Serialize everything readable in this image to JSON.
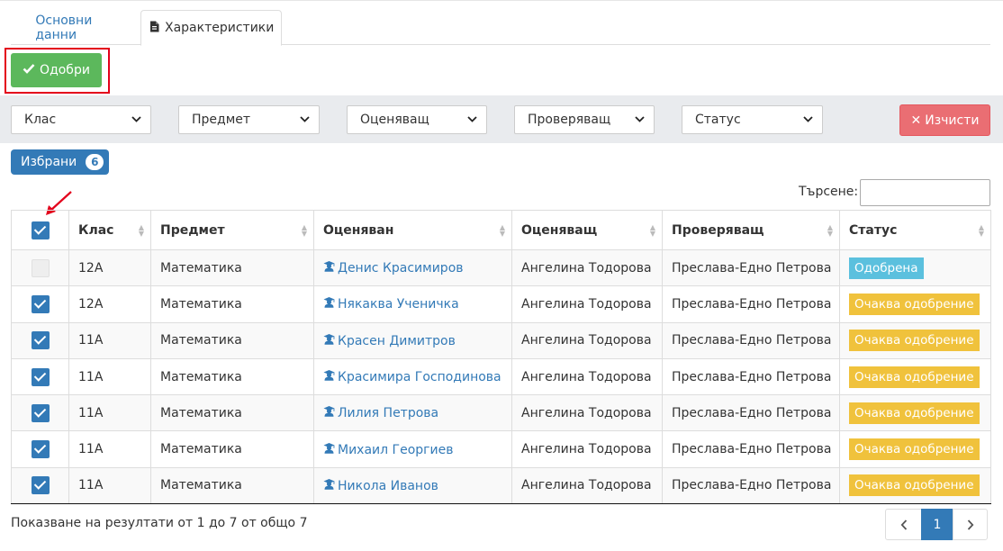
{
  "tabs": [
    {
      "label": "Основни данни",
      "icon": "grid-icon"
    },
    {
      "label": "Характеристики",
      "icon": "file-icon"
    }
  ],
  "toolbar": {
    "approve_label": "Одобри"
  },
  "filters": [
    {
      "label": "Клас"
    },
    {
      "label": "Предмет"
    },
    {
      "label": "Оценяващ"
    },
    {
      "label": "Проверяващ"
    },
    {
      "label": "Статус"
    }
  ],
  "clear_label": "Изчисти",
  "selected": {
    "label": "Избрани",
    "count": "6"
  },
  "search": {
    "label": "Търсене:",
    "value": ""
  },
  "table": {
    "headers": [
      "Клас",
      "Предмет",
      "Оценяван",
      "Оценяващ",
      "Проверяващ",
      "Статус"
    ],
    "rows": [
      {
        "checked": false,
        "class": "12А",
        "subject": "Математика",
        "student": "Денис Красимиров",
        "assessor": "Ангелина Тодорова",
        "reviewer": "Преслава-Едно Петрова",
        "status": "Одобрена",
        "status_type": "approved"
      },
      {
        "checked": true,
        "class": "12А",
        "subject": "Математика",
        "student": "Някаква Ученичка",
        "assessor": "Ангелина Тодорова",
        "reviewer": "Преслава-Едно Петрова",
        "status": "Очаква одобрение",
        "status_type": "pending"
      },
      {
        "checked": true,
        "class": "11А",
        "subject": "Математика",
        "student": "Красен Димитров",
        "assessor": "Ангелина Тодорова",
        "reviewer": "Преслава-Едно Петрова",
        "status": "Очаква одобрение",
        "status_type": "pending"
      },
      {
        "checked": true,
        "class": "11А",
        "subject": "Математика",
        "student": "Красимира Господинова",
        "assessor": "Ангелина Тодорова",
        "reviewer": "Преслава-Едно Петрова",
        "status": "Очаква одобрение",
        "status_type": "pending"
      },
      {
        "checked": true,
        "class": "11А",
        "subject": "Математика",
        "student": "Лилия Петрова",
        "assessor": "Ангелина Тодорова",
        "reviewer": "Преслава-Едно Петрова",
        "status": "Очаква одобрение",
        "status_type": "pending"
      },
      {
        "checked": true,
        "class": "11А",
        "subject": "Математика",
        "student": "Михаил Георгиев",
        "assessor": "Ангелина Тодорова",
        "reviewer": "Преслава-Едно Петрова",
        "status": "Очаква одобрение",
        "status_type": "pending"
      },
      {
        "checked": true,
        "class": "11А",
        "subject": "Математика",
        "student": "Никола Иванов",
        "assessor": "Ангелина Тодорова",
        "reviewer": "Преслава-Едно Петрова",
        "status": "Очаква одобрение",
        "status_type": "pending"
      }
    ]
  },
  "footer": {
    "info": "Показване на резултати от 1 до 7 от общо 7"
  },
  "pagination": {
    "prev": "‹",
    "current": "1",
    "next": "›"
  },
  "colors": {
    "primary": "#337ab7",
    "success": "#5cb85c",
    "danger": "#ea6e73",
    "approved": "#5bc0de",
    "pending": "#f0c23c",
    "highlight": "#e3001b"
  }
}
